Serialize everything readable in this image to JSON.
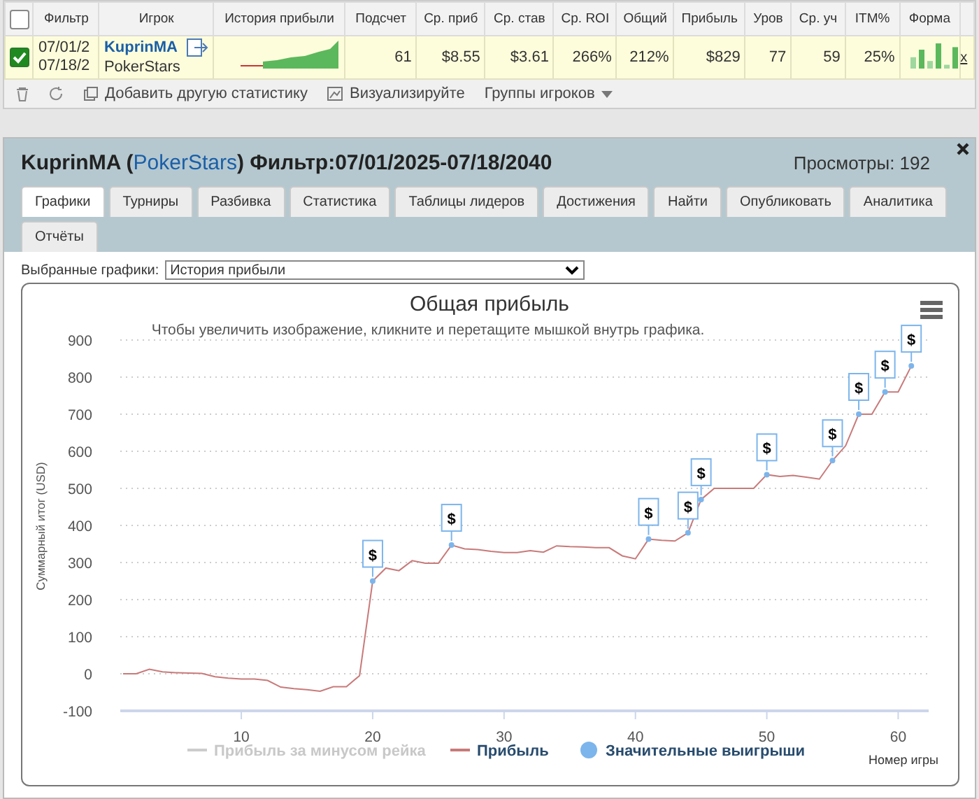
{
  "table": {
    "header_checked": false,
    "columns": [
      "Фильтр",
      "Игрок",
      "История прибыли",
      "Подсчет",
      "Ср. приб",
      "Ср. став",
      "Ср. ROI",
      "Общий",
      "Прибыль",
      "Уров",
      "Ср. уч",
      "ITM%",
      "Форма"
    ],
    "rows": [
      {
        "checked": true,
        "remove": "x",
        "cells": [
          {
            "kind": "dates",
            "lines": [
              "07/01/2",
              "07/18/2"
            ]
          },
          {
            "kind": "player",
            "name": "KuprinMA",
            "site": "PokerStars"
          },
          {
            "kind": "sparkline"
          },
          {
            "kind": "value",
            "text": "61"
          },
          {
            "kind": "value",
            "text": "$8.55"
          },
          {
            "kind": "value",
            "text": "$3.61"
          },
          {
            "kind": "value",
            "text": "266%"
          },
          {
            "kind": "value",
            "text": "212%"
          },
          {
            "kind": "value",
            "text": "$829"
          },
          {
            "kind": "value",
            "text": "77"
          },
          {
            "kind": "value",
            "text": "59"
          },
          {
            "kind": "value",
            "text": "25%"
          },
          {
            "kind": "form"
          }
        ]
      }
    ]
  },
  "toolbar": {
    "add_stat": "Добавить другую статистику",
    "visualize": "Визуализируйте",
    "groups": "Группы игроков"
  },
  "panel": {
    "title_parts": [
      {
        "kind": "plain",
        "text": "KuprinMA ("
      },
      {
        "kind": "link",
        "text": "PokerStars"
      },
      {
        "kind": "plain",
        "text": ") Фильтр:07/01/2025-07/18/2040"
      }
    ],
    "views": "Просмотры: 192",
    "tabs": [
      {
        "label": "Графики",
        "selected": true
      },
      {
        "label": "Турниры",
        "selected": false
      },
      {
        "label": "Разбивка",
        "selected": false
      },
      {
        "label": "Статистика",
        "selected": false
      },
      {
        "label": "Таблицы лидеров",
        "selected": false
      },
      {
        "label": "Достижения",
        "selected": false
      },
      {
        "label": "Найти",
        "selected": false
      },
      {
        "label": "Опубликовать",
        "selected": false
      },
      {
        "label": "Аналитика",
        "selected": false
      },
      {
        "label": "Отчёты",
        "selected": false
      }
    ],
    "selector": {
      "label": "Выбранные графики:",
      "value": "История прибыли"
    },
    "chart": {
      "subtitle": "Чтобы увеличить изображение, кликните и перетащите мышкой внутрь графика.",
      "legend_extra": [
        {
          "label": "Прибыль за минусом рейка",
          "visible": false
        }
      ],
      "chart_data": {
        "type": "line",
        "title": "Общая прибыль",
        "xlabel": "Номер игры",
        "ylabel": "Суммарный итог (USD)",
        "grid": true,
        "legend": "bottom",
        "x": [
          1,
          2,
          3,
          4,
          5,
          6,
          7,
          8,
          9,
          10,
          11,
          12,
          13,
          14,
          15,
          16,
          17,
          18,
          19,
          20,
          21,
          22,
          23,
          24,
          25,
          26,
          27,
          28,
          29,
          30,
          31,
          32,
          33,
          34,
          35,
          36,
          37,
          38,
          39,
          40,
          41,
          42,
          43,
          44,
          45,
          46,
          47,
          48,
          49,
          50,
          51,
          52,
          53,
          54,
          55,
          56,
          57,
          58,
          59,
          60,
          61
        ],
        "series": [
          {
            "name": "Прибыль",
            "color": "#c97a7a",
            "values": [
              0,
              0,
              12,
              5,
              3,
              2,
              1,
              -8,
              -12,
              -14,
              -14,
              -18,
              -36,
              -40,
              -43,
              -47,
              -35,
              -35,
              -5,
              250,
              285,
              278,
              305,
              298,
              298,
              347,
              337,
              335,
              330,
              327,
              327,
              332,
              328,
              345,
              343,
              342,
              340,
              340,
              318,
              310,
              363,
              360,
              358,
              380,
              470,
              500,
              500,
              500,
              500,
              537,
              532,
              535,
              530,
              525,
              575,
              615,
              700,
              700,
              760,
              760,
              830
            ]
          },
          {
            "name": "Значительные выигрыши",
            "type": "scatter",
            "marker": "circle",
            "color": "#7cb5ec",
            "values": [
              null,
              null,
              null,
              null,
              null,
              null,
              null,
              null,
              null,
              null,
              null,
              null,
              null,
              null,
              null,
              null,
              null,
              null,
              null,
              250,
              null,
              null,
              null,
              null,
              null,
              347,
              null,
              null,
              null,
              null,
              null,
              null,
              null,
              null,
              null,
              null,
              null,
              null,
              null,
              null,
              363,
              null,
              null,
              380,
              470,
              null,
              null,
              null,
              null,
              537,
              null,
              null,
              null,
              null,
              575,
              null,
              700,
              null,
              760,
              null,
              830
            ]
          }
        ],
        "xlim": [
          1,
          62
        ],
        "ylim": [
          -100,
          900
        ],
        "xticks": [
          10,
          20,
          30,
          40,
          50,
          60
        ],
        "yticks": [
          -100,
          0,
          100,
          200,
          300,
          400,
          500,
          600,
          700,
          800,
          900
        ],
        "annotations": [
          {
            "x": 20,
            "text": "$"
          },
          {
            "x": 26,
            "text": "$"
          },
          {
            "x": 41,
            "text": "$"
          },
          {
            "x": 44,
            "text": "$"
          },
          {
            "x": 45,
            "text": "$"
          },
          {
            "x": 50,
            "text": "$"
          },
          {
            "x": 55,
            "text": "$"
          },
          {
            "x": 57,
            "text": "$"
          },
          {
            "x": 59,
            "text": "$"
          },
          {
            "x": 61,
            "text": "$"
          }
        ]
      }
    }
  }
}
